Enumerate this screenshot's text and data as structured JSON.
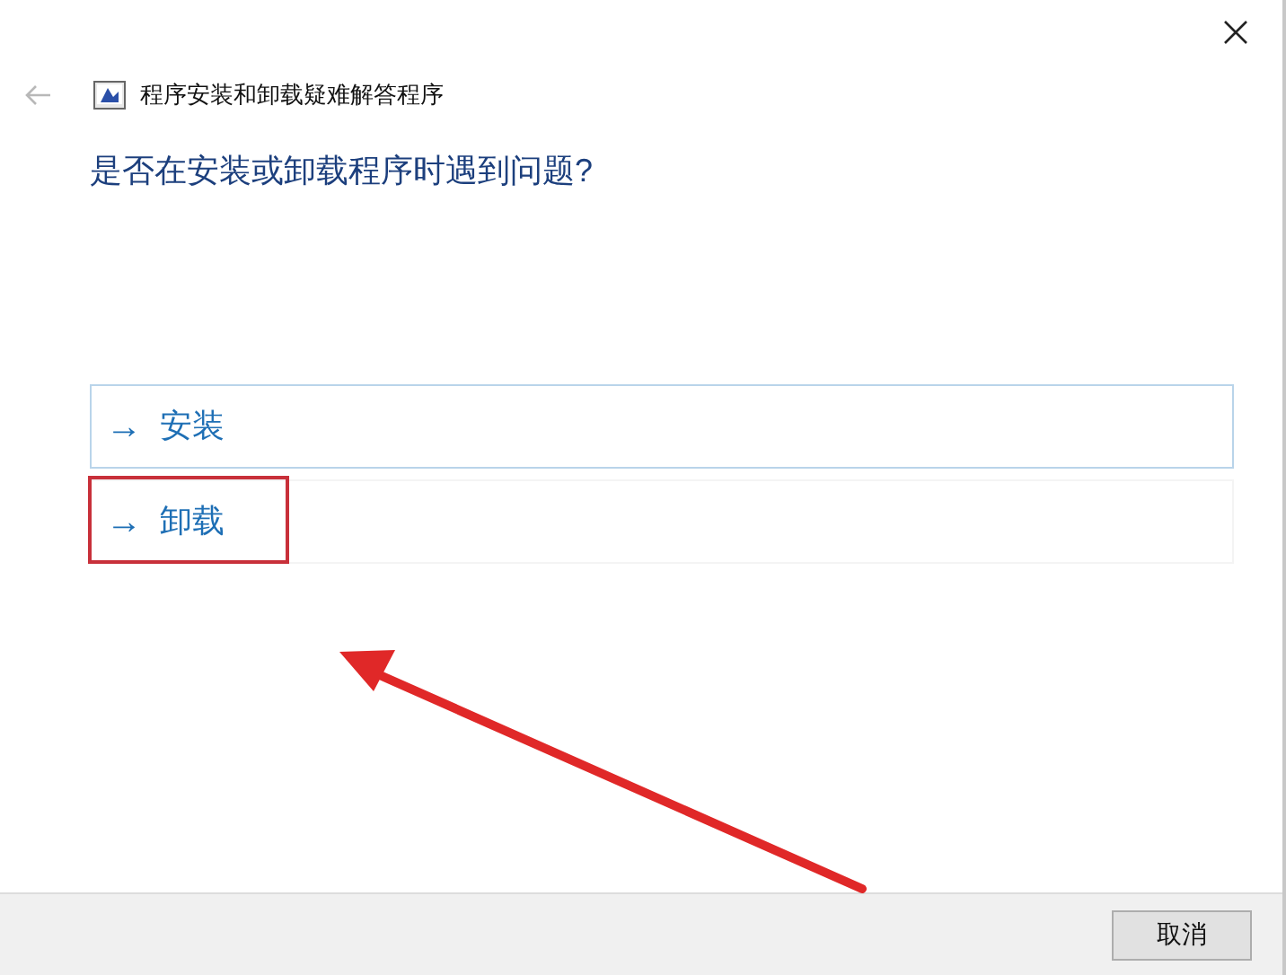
{
  "window": {
    "title": "程序安装和卸载疑难解答程序"
  },
  "heading": "是否在安装或卸载程序时遇到问题?",
  "options": [
    {
      "arrow": "→",
      "label": "安装",
      "selected": true,
      "highlighted": false
    },
    {
      "arrow": "→",
      "label": "卸载",
      "selected": false,
      "highlighted": true
    }
  ],
  "buttons": [
    "取消"
  ]
}
